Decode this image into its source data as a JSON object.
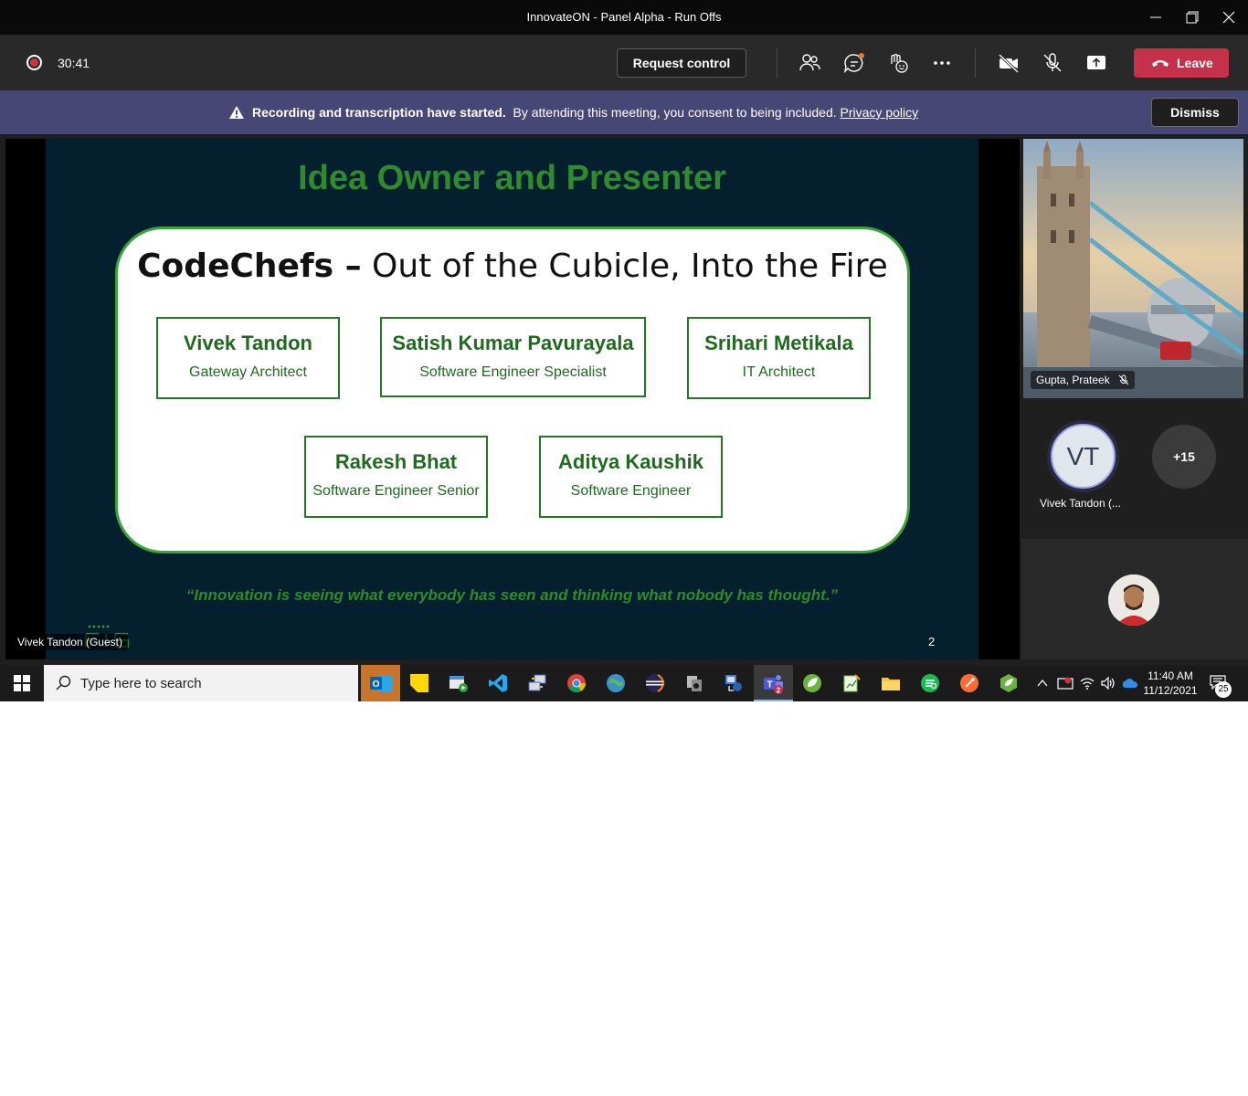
{
  "window": {
    "title": "InnovateON - Panel Alpha - Run Offs",
    "controls": [
      "minimize-icon",
      "restore-icon",
      "close-icon"
    ]
  },
  "toolbar": {
    "recording_icon": "record-icon",
    "timer": "30:41",
    "request_control_label": "Request control",
    "icons": [
      "participants-icon",
      "chat-icon",
      "reactions-icon",
      "more-options-icon",
      "camera-off-icon",
      "mic-off-icon",
      "share-screen-icon"
    ],
    "leave_label": "Leave",
    "leave_color": "#c4314b"
  },
  "banner": {
    "bold_text": "Recording and transcription have started.",
    "text": "By attending this meeting, you consent to being included.",
    "link_text": "Privacy policy",
    "dismiss_label": "Dismiss",
    "background": "#464775"
  },
  "shared_screen": {
    "presenter_label": "Vivek Tandon (Guest)",
    "slide": {
      "title": "Idea Owner and Presenter",
      "team_name": "CodeChefs –",
      "team_tagline": "Out of the Cubicle, Into the Fire",
      "members": [
        {
          "name": "Vivek Tandon",
          "role": "Gateway Architect"
        },
        {
          "name": "Satish Kumar Pavurayala",
          "role": "Software Engineer Specialist"
        },
        {
          "name": "Srihari Metikala",
          "role": "IT Architect"
        },
        {
          "name": "Rakesh Bhat",
          "role": "Software Engineer Senior"
        },
        {
          "name": "Aditya Kaushik",
          "role": "Software Engineer"
        }
      ],
      "quote": "“Innovation is seeing what everybody has seen and thinking what nobody has thought.”",
      "logo": "FIS",
      "page_number": "2",
      "accent_color": "#2e8b2e"
    }
  },
  "participants": {
    "video_tile_name": "Gupta, Prateek",
    "avatar_initials": "VT",
    "avatar_name": "Vivek Tandon (...",
    "overflow_count": "+15"
  },
  "taskbar": {
    "search_placeholder": "Type here to search",
    "apps": [
      "outlook-icon",
      "sticky-notes-icon",
      "media-player-icon",
      "vscode-icon",
      "remote-desktop-icon",
      "chrome-icon",
      "browser-icon",
      "eclipse-icon",
      "file-copy-icon",
      "network-icon",
      "teams-icon",
      "spring-icon",
      "notepad-icon",
      "file-explorer-icon",
      "spotify-like-icon",
      "postman-icon",
      "spring-boot-icon"
    ],
    "teams_badge": "2",
    "time": "11:40 AM",
    "date": "11/12/2021",
    "notification_count": "25"
  }
}
